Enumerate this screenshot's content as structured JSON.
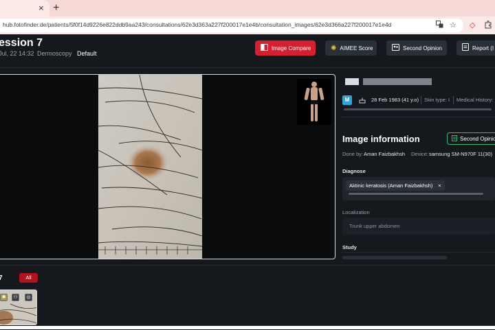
{
  "browser": {
    "tab_close": "×",
    "new_tab": "+",
    "url": "hub.fotofinder.de/patients/5f0f14d9226e822ddb9aa243/consultations/62e3d363a227f200017e1e4b/consultation_images/62e3d366a227f200017e1e4d"
  },
  "header": {
    "title": "ession 7",
    "date": "Jul, 22 14:32",
    "mode": "Dermoscopy",
    "view": "Default",
    "buttons": {
      "image_compare": "Image Compare",
      "aimee_score": "AIMEE Score",
      "second_opinion": "Second Opinion",
      "report": "Report (I"
    }
  },
  "patient": {
    "gender_badge": "M",
    "birth": "28 Feb 1983 (41 y.o)",
    "skin_type": "Skin type: I",
    "medical_history": "Medical History:"
  },
  "image_information": {
    "title": "Image information",
    "second_opinion": "Second Opinion",
    "done_by_label": "Done by:",
    "done_by": "Aman Faizbakhsh",
    "device_label": "Device:",
    "device": "samsung SM-N970F 11(30)",
    "diagnose_label": "Diagnose",
    "diagnose_chip": "Aktinic keratosis (Aman Faizbakhsh)",
    "chip_remove": "×",
    "localization_label": "Localization",
    "localization": "Trunk upper abdomen",
    "study_label": "Study"
  },
  "gallery": {
    "count": "7",
    "filter": "All"
  },
  "colors": {
    "accent_red": "#d81f2f",
    "badge_blue": "#2ca6d9",
    "outline_green": "#2fbf71"
  }
}
